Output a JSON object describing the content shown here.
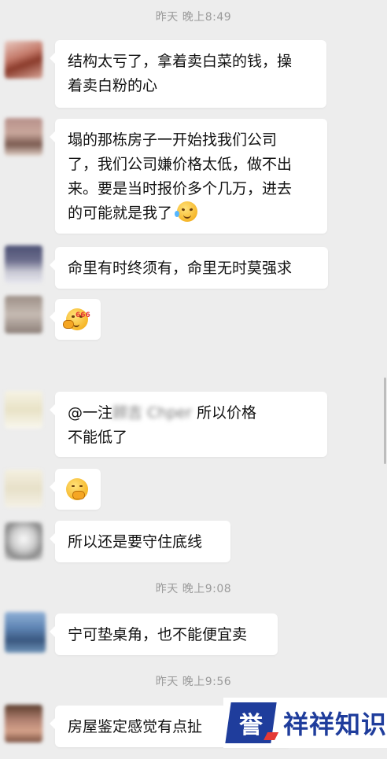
{
  "timestamps": [
    "昨天 晚上8:49",
    "昨天 晚上9:08",
    "昨天 晚上9:56"
  ],
  "messages": [
    {
      "text_lines": [
        "结构太亏了，拿着卖白菜的钱，操",
        "着卖白粉的心"
      ]
    },
    {
      "text_lines": [
        "塌的那栋房子一开始找我们公司",
        "了，我们公司嫌价格太低，做不出",
        "来。要是当时报价多个几万，进去",
        "的可能就是我了"
      ],
      "emoji": "laugh-cry-emoji"
    },
    {
      "text_lines": [
        "命里有时终须有，命里无时莫强求"
      ]
    },
    {
      "emoji": "666-emoji"
    },
    {
      "mention_prefix": "@一注",
      "mention_blur": "顾吉 Ch",
      "mention_blur2": "per",
      "text_after": " 所以价格",
      "text_line2": "不能低了"
    },
    {
      "emoji": "shy-emoji"
    },
    {
      "text_lines": [
        "所以还是要守住底线"
      ]
    },
    {
      "text_lines": [
        "宁可垫桌角，也不能便宜卖"
      ]
    },
    {
      "text_lines": [
        "房屋鉴定感觉有点扯"
      ]
    }
  ],
  "watermark": {
    "logo_char": "誉",
    "text": "祥祥知识",
    "brand_color": "#1f3d9c"
  },
  "colors": {
    "background": "#ededed",
    "bubble": "#ffffff",
    "timestamp": "#9a9a9a"
  }
}
